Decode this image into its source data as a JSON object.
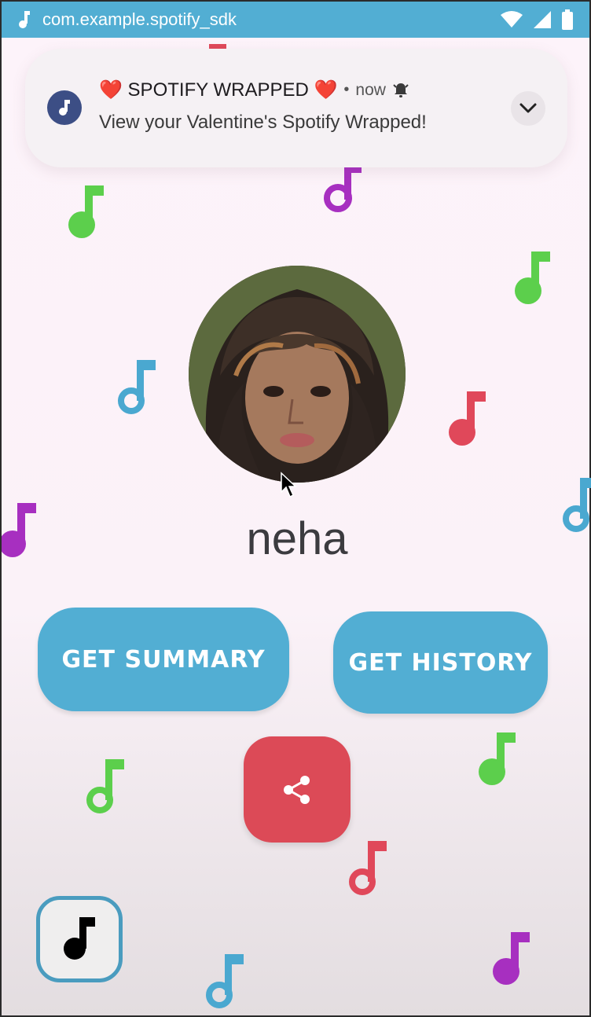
{
  "status_bar": {
    "package": "com.example.spotify_sdk",
    "icons": [
      "music-note-icon",
      "wifi-icon",
      "signal-icon",
      "battery-icon"
    ]
  },
  "notification": {
    "title": "❤️ SPOTIFY WRAPPED ❤️",
    "time": "now",
    "text": "View your Valentine's Spotify Wrapped!",
    "icons": [
      "music-note-icon",
      "bell-icon",
      "chevron-down-icon"
    ]
  },
  "profile": {
    "username": "neha"
  },
  "buttons": {
    "summary": "GET SUMMARY",
    "history": "GET HISTORY"
  },
  "colors": {
    "accent_blue": "#52aed3",
    "share_red": "#dc4a57",
    "note_green": "#5ccf4c",
    "note_purple": "#a72fc0",
    "note_red": "#e0485a",
    "note_blue": "#4aa8d0"
  }
}
